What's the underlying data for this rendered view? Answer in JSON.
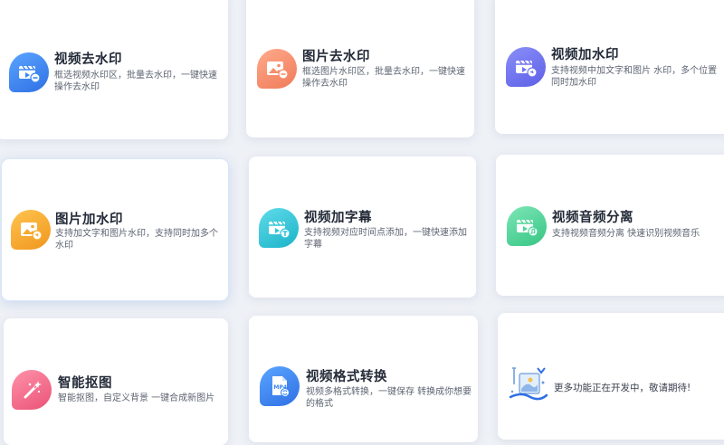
{
  "features": [
    {
      "title": "视频去水印",
      "desc": "框选视频水印区，批量去水印，一键快速操作去水印",
      "icon": "video-remove-watermark-icon",
      "color": "#3a86f2"
    },
    {
      "title": "图片去水印",
      "desc": "框选图片水印区，批量去水印，一键快速操作去水印",
      "icon": "image-remove-watermark-icon",
      "color": "#f58e6d"
    },
    {
      "title": "视频加水印",
      "desc": "支持视频中加文字和图片 水印，多个位置同时加水印",
      "icon": "video-add-watermark-icon",
      "color": "#6f74ef"
    },
    {
      "title": "图片加水印",
      "desc": "支持加文字和图片水印，支持同时加多个水印",
      "icon": "image-add-watermark-icon",
      "color": "#f4aa2d"
    },
    {
      "title": "视频加字幕",
      "desc": "支持视频对应时间点添加，一键快速添加字幕",
      "icon": "video-subtitle-icon",
      "color": "#2fc6d9"
    },
    {
      "title": "视频音频分离",
      "desc": "支持视频音频分离 快速识别视频音乐",
      "icon": "audio-separate-icon",
      "color": "#4ed59a"
    },
    {
      "title": "智能抠图",
      "desc": "智能抠图，自定义背景 一键合成新图片",
      "icon": "magic-wand-icon",
      "color": "#f56f8c"
    },
    {
      "title": "视频格式转换",
      "desc": "视频多格式转换，一键保存 转换成你想要的格式",
      "icon": "mp4-file-icon",
      "color": "#3a86f2"
    }
  ],
  "coming_soon": {
    "text": "更多功能正在开发中，敬请期待!",
    "icon": "under-development-icon"
  }
}
